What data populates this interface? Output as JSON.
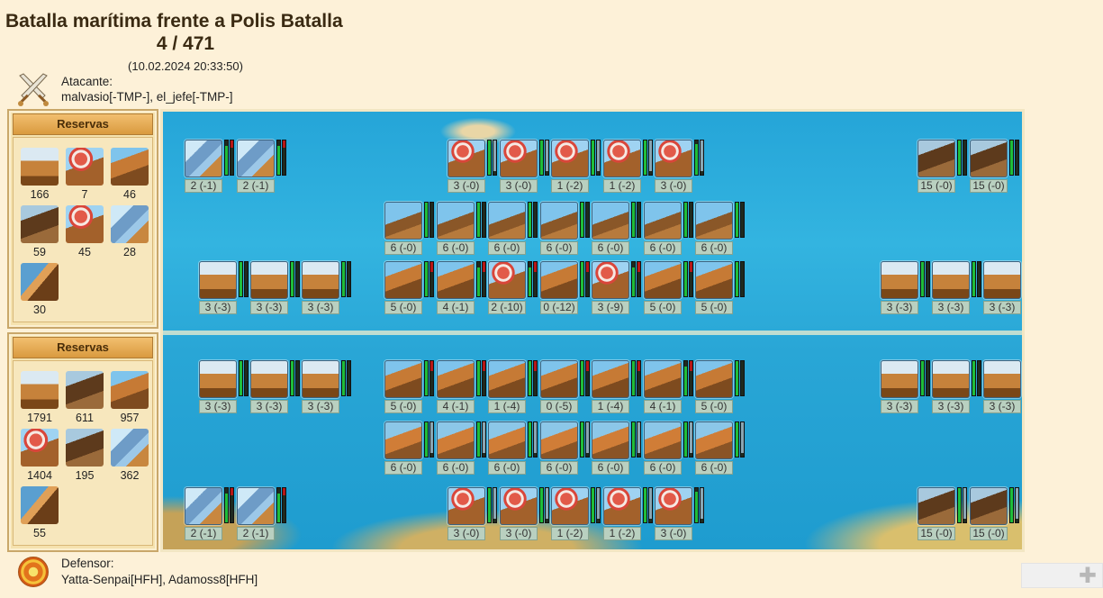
{
  "header": {
    "title": "Batalla marítima frente a Polis Batalla",
    "round": "4 / 471",
    "timestamp": "(10.02.2024 20:33:50)"
  },
  "attacker": {
    "label": "Atacante:",
    "players": "malvasio[-TMP-], el_jefe[-TMP-]",
    "icon": "crossed-swords-icon"
  },
  "defender": {
    "label": "Defensor:",
    "players": "Yatta-Senpai[HFH], Adamoss8[HFH]",
    "icon": "shield-emblem-icon"
  },
  "reserves_attacker": {
    "title": "Reservas",
    "units": [
      {
        "type": "steam",
        "count": "166"
      },
      {
        "type": "balista",
        "count": "7"
      },
      {
        "type": "ram",
        "count": "46"
      },
      {
        "type": "submarine",
        "count": "59"
      },
      {
        "type": "balista",
        "count": "45"
      },
      {
        "type": "bireme",
        "count": "28"
      },
      {
        "type": "tender",
        "count": "30"
      }
    ]
  },
  "reserves_defender": {
    "title": "Reservas",
    "units": [
      {
        "type": "steam",
        "count": "1791"
      },
      {
        "type": "submarine",
        "count": "611"
      },
      {
        "type": "ram",
        "count": "957"
      },
      {
        "type": "balista",
        "count": "1404"
      },
      {
        "type": "submarine",
        "count": "195"
      },
      {
        "type": "bireme",
        "count": "362"
      },
      {
        "type": "tender",
        "count": "55"
      }
    ]
  },
  "battlefield": {
    "attacker_rows": [
      {
        "row": "support",
        "units": [
          {
            "type": "bireme",
            "label": "2 (-1)",
            "health": 0.85,
            "ammo": 0.2
          },
          {
            "type": "bireme",
            "label": "2 (-1)",
            "health": 0.85,
            "ammo": 0.2
          },
          {
            "type": "balista",
            "label": "3 (-0)",
            "health": 1,
            "ammo": 0.9
          },
          {
            "type": "balista",
            "label": "3 (-0)",
            "health": 1,
            "ammo": 0.9
          },
          {
            "type": "balista",
            "label": "1 (-2)",
            "health": 1,
            "ammo": 0.9
          },
          {
            "type": "balista",
            "label": "1 (-2)",
            "health": 1,
            "ammo": 0.9
          },
          {
            "type": "balista",
            "label": "3 (-0)",
            "health": 0.9,
            "ammo": 0.9
          },
          {
            "type": "submarine",
            "label": "15 (-0)",
            "health": 1,
            "ammo": 0
          },
          {
            "type": "submarine",
            "label": "15 (-0)",
            "health": 1,
            "ammo": 0
          }
        ]
      },
      {
        "row": "long_range",
        "units": [
          {
            "type": "trireme",
            "label": "6 (-0)",
            "health": 1,
            "ammo": 0
          },
          {
            "type": "trireme",
            "label": "6 (-0)",
            "health": 1,
            "ammo": 0
          },
          {
            "type": "trireme",
            "label": "6 (-0)",
            "health": 1,
            "ammo": 0
          },
          {
            "type": "trireme",
            "label": "6 (-0)",
            "health": 1,
            "ammo": 0
          },
          {
            "type": "trireme",
            "label": "6 (-0)",
            "health": 1,
            "ammo": 0
          },
          {
            "type": "trireme",
            "label": "6 (-0)",
            "health": 1,
            "ammo": 0
          },
          {
            "type": "trireme",
            "label": "6 (-0)",
            "health": 1,
            "ammo": 0
          }
        ]
      },
      {
        "row": "front",
        "units": [
          {
            "type": "steam",
            "label": "3 (-3)",
            "health": 1,
            "ammo": 0
          },
          {
            "type": "steam",
            "label": "3 (-3)",
            "health": 1,
            "ammo": 0
          },
          {
            "type": "steam",
            "label": "3 (-3)",
            "health": 1,
            "ammo": 0
          },
          {
            "type": "ram",
            "label": "5 (-0)",
            "health": 1,
            "ammo": 0.3
          },
          {
            "type": "ram",
            "label": "4 (-1)",
            "health": 0.85,
            "ammo": 0.3
          },
          {
            "type": "balista",
            "label": "2 (-10)",
            "health": 0.85,
            "ammo": 0.3
          },
          {
            "type": "ram",
            "label": "0 (-12)",
            "health": 1,
            "ammo": 0.3
          },
          {
            "type": "balista",
            "label": "3 (-9)",
            "health": 0.85,
            "ammo": 0.3
          },
          {
            "type": "ram",
            "label": "5 (-0)",
            "health": 1,
            "ammo": 0.3
          },
          {
            "type": "ram",
            "label": "5 (-0)",
            "health": 1,
            "ammo": 0
          },
          {
            "type": "steam",
            "label": "3 (-3)",
            "health": 1,
            "ammo": 0
          },
          {
            "type": "steam",
            "label": "3 (-3)",
            "health": 1,
            "ammo": 0
          },
          {
            "type": "steam",
            "label": "3 (-3)",
            "health": 1,
            "ammo": 0
          }
        ]
      }
    ],
    "defender_rows": [
      {
        "row": "front",
        "units": [
          {
            "type": "steam",
            "label": "3 (-3)",
            "health": 1,
            "ammo": 0
          },
          {
            "type": "steam",
            "label": "3 (-3)",
            "health": 1,
            "ammo": 0
          },
          {
            "type": "steam",
            "label": "3 (-3)",
            "health": 1,
            "ammo": 0
          },
          {
            "type": "ram",
            "label": "5 (-0)",
            "health": 1,
            "ammo": 0.3
          },
          {
            "type": "ram",
            "label": "4 (-1)",
            "health": 1,
            "ammo": 0.3
          },
          {
            "type": "ram",
            "label": "1 (-4)",
            "health": 1,
            "ammo": 0.3
          },
          {
            "type": "ram",
            "label": "0 (-5)",
            "health": 1,
            "ammo": 0.3
          },
          {
            "type": "ram",
            "label": "1 (-4)",
            "health": 1,
            "ammo": 0.3
          },
          {
            "type": "ram",
            "label": "4 (-1)",
            "health": 0.85,
            "ammo": 0.3
          },
          {
            "type": "ram",
            "label": "5 (-0)",
            "health": 1,
            "ammo": 0
          },
          {
            "type": "steam",
            "label": "3 (-3)",
            "health": 1,
            "ammo": 0
          },
          {
            "type": "steam",
            "label": "3 (-3)",
            "health": 1,
            "ammo": 0
          },
          {
            "type": "steam",
            "label": "3 (-3)",
            "health": 1,
            "ammo": 0
          }
        ]
      },
      {
        "row": "long_range",
        "units": [
          {
            "type": "catapult",
            "label": "6 (-0)",
            "health": 1,
            "ammo": 0.9
          },
          {
            "type": "catapult",
            "label": "6 (-0)",
            "health": 1,
            "ammo": 0.9
          },
          {
            "type": "catapult",
            "label": "6 (-0)",
            "health": 1,
            "ammo": 0.9
          },
          {
            "type": "catapult",
            "label": "6 (-0)",
            "health": 1,
            "ammo": 0.9
          },
          {
            "type": "catapult",
            "label": "6 (-0)",
            "health": 1,
            "ammo": 0.9
          },
          {
            "type": "catapult",
            "label": "6 (-0)",
            "health": 1,
            "ammo": 0.9
          },
          {
            "type": "catapult",
            "label": "6 (-0)",
            "health": 1,
            "ammo": 0.9
          }
        ]
      },
      {
        "row": "support",
        "units": [
          {
            "type": "bireme",
            "label": "2 (-1)",
            "health": 0.85,
            "ammo": 0.2
          },
          {
            "type": "bireme",
            "label": "2 (-1)",
            "health": 0.85,
            "ammo": 0.2
          },
          {
            "type": "balista",
            "label": "3 (-0)",
            "health": 1,
            "ammo": 0.9
          },
          {
            "type": "balista",
            "label": "3 (-0)",
            "health": 1,
            "ammo": 0.9
          },
          {
            "type": "balista",
            "label": "1 (-2)",
            "health": 1,
            "ammo": 0.9
          },
          {
            "type": "balista",
            "label": "1 (-2)",
            "health": 1,
            "ammo": 0.9
          },
          {
            "type": "balista",
            "label": "3 (-0)",
            "health": 0.9,
            "ammo": 0.9
          },
          {
            "type": "submarine",
            "label": "15 (-0)",
            "health": 1,
            "ammo": 0.9
          },
          {
            "type": "submarine",
            "label": "15 (-0)",
            "health": 1,
            "ammo": 0.9
          }
        ]
      }
    ]
  },
  "colors": {
    "health": "#1fbe3a",
    "ammo": "#b81616",
    "label_bg": "#b9d0c0",
    "sea": "#29a6d6",
    "panel": "#f5e2ae"
  }
}
